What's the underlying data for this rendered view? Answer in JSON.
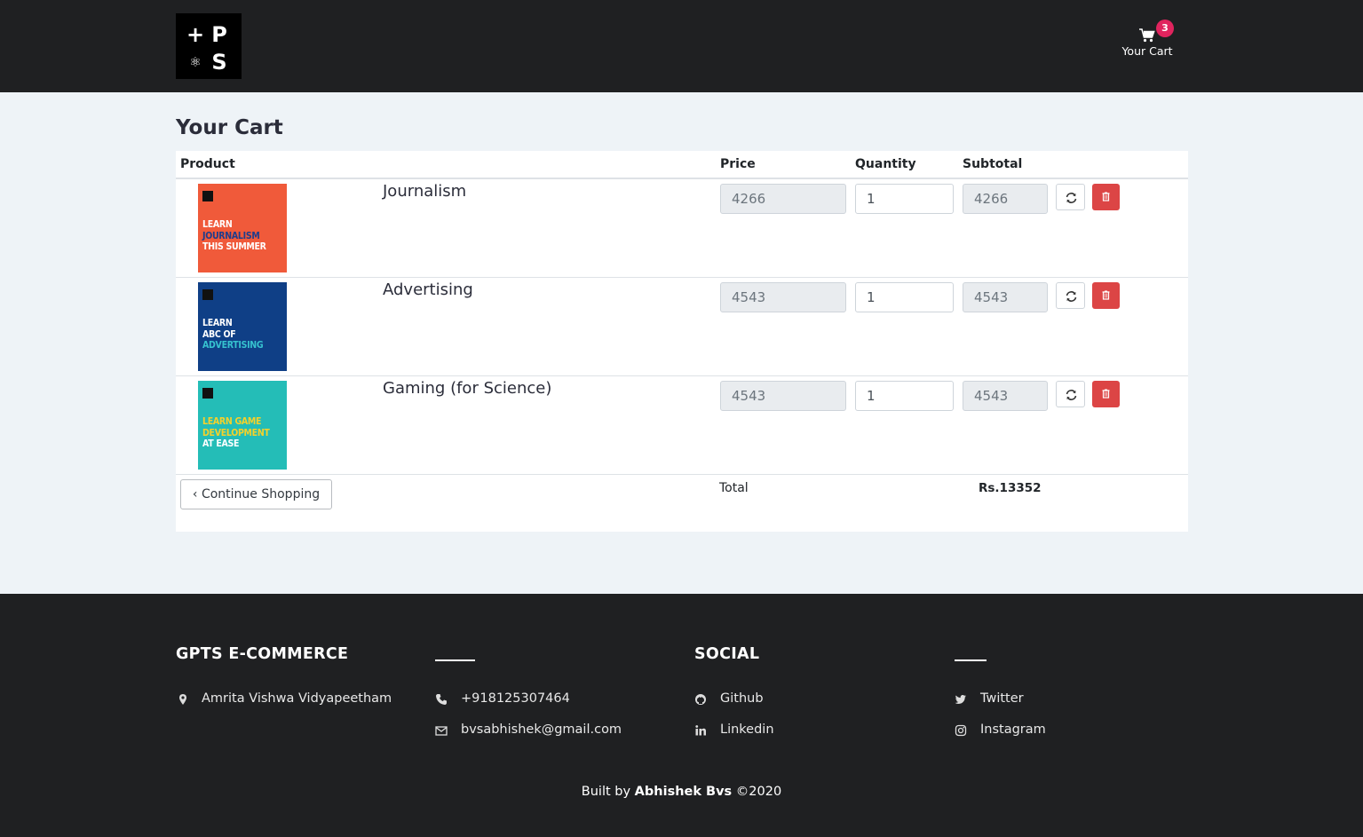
{
  "header": {
    "logo": {
      "tl": "+",
      "tr": "P",
      "bl": "⚛",
      "br": "S"
    },
    "cart_badge": "3",
    "cart_label": "Your Cart"
  },
  "page_title": "Your Cart",
  "table": {
    "columns": {
      "product": "Product",
      "price": "Price",
      "quantity": "Quantity",
      "subtotal": "Subtotal"
    },
    "rows": [
      {
        "name": "Journalism",
        "price": "4266",
        "quantity": "1",
        "subtotal": "4266",
        "thumb": {
          "bg": "#f05a3a",
          "lines": [
            "LEARN",
            "JOURNALISM",
            "THIS SUMMER"
          ],
          "line_colors": [
            "#ffffff",
            "#1e3c8c",
            "#ffffff"
          ]
        }
      },
      {
        "name": "Advertising",
        "price": "4543",
        "quantity": "1",
        "subtotal": "4543",
        "thumb": {
          "bg": "#0f3f86",
          "lines": [
            "LEARN",
            "ABC OF",
            "ADVERTISING"
          ],
          "line_colors": [
            "#ffffff",
            "#ffffff",
            "#36c2cf"
          ]
        }
      },
      {
        "name": "Gaming (for Science)",
        "price": "4543",
        "quantity": "1",
        "subtotal": "4543",
        "thumb": {
          "bg": "#24bdb7",
          "lines": [
            "LEARN GAME",
            "DEVELOPMENT",
            "AT EASE"
          ],
          "line_colors": [
            "#f5d12a",
            "#f5d12a",
            "#ffffff"
          ]
        }
      }
    ]
  },
  "continue_label": "Continue Shopping",
  "total_label": "Total",
  "total_value": "Rs.13352",
  "footer": {
    "col1_title": "GPTS E-COMMERCE",
    "col3_title": "SOCIAL",
    "address": "Amrita Vishwa Vidyapeetham",
    "phone": "+918125307464",
    "email": "bvsabhishek@gmail.com",
    "github": "Github",
    "linkedin": "Linkedin",
    "twitter": "Twitter",
    "instagram": "Instagram",
    "credit_prefix": "Built by",
    "credit_name": "Abhishek Bvs",
    "credit_suffix": "©2020"
  }
}
